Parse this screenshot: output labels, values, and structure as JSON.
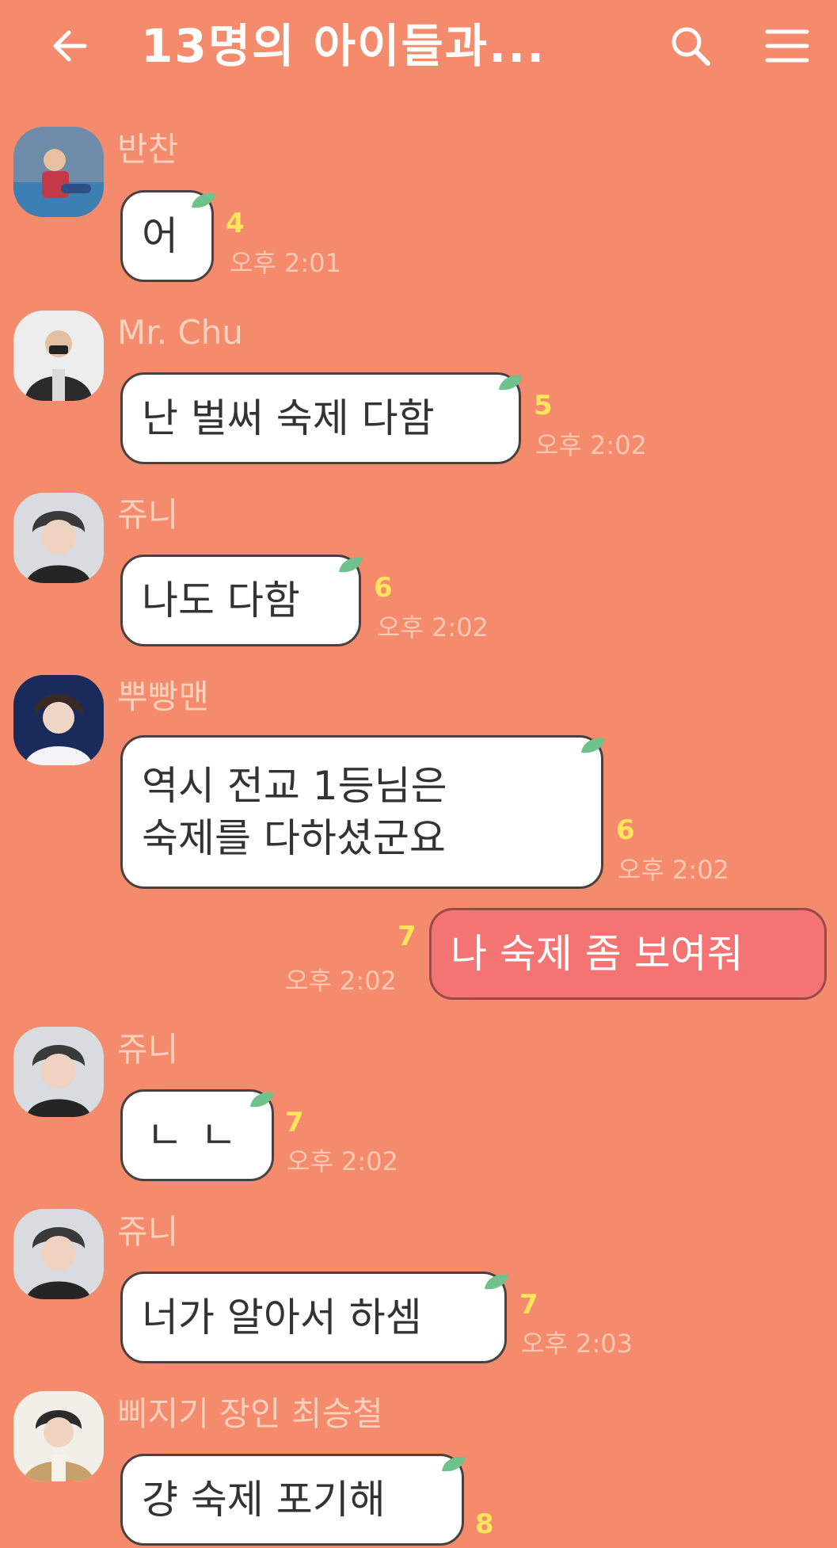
{
  "header": {
    "title": "13명의 아이들과...",
    "back_icon": "arrow-left-icon",
    "search_icon": "search-icon",
    "menu_icon": "hamburger-menu-icon"
  },
  "colors": {
    "background": "#F48B6D",
    "bubble_in": "#FFFFFF",
    "bubble_out": "#F47474",
    "unread": "#FFE45C",
    "meta_text": "#FBC8B4"
  },
  "messages": [
    {
      "sender": "반찬",
      "text": "어",
      "unread": "4",
      "time": "오후 2:01"
    },
    {
      "sender": "Mr. Chu",
      "text": "난 벌써 숙제 다함",
      "unread": "5",
      "time": "오후 2:02"
    },
    {
      "sender": "쥬니",
      "text": "나도 다함",
      "unread": "6",
      "time": "오후 2:02"
    },
    {
      "sender": "뿌빵맨",
      "text": "역시 전교 1등님은\n숙제를 다하셨군요",
      "unread": "6",
      "time": "오후 2:02"
    },
    {
      "sender": "",
      "text": "나 숙제 좀 보여줘",
      "unread": "7",
      "time": "오후 2:02",
      "outgoing": true
    },
    {
      "sender": "쥬니",
      "text": "ㄴㄴ",
      "unread": "7",
      "time": "오후 2:02"
    },
    {
      "sender": "쥬니",
      "text": "너가 알아서 하셈",
      "unread": "7",
      "time": "오후 2:03"
    },
    {
      "sender": "삐지기 장인 최승철",
      "text": "걍 숙제 포기해",
      "unread": "8",
      "time": ""
    }
  ]
}
